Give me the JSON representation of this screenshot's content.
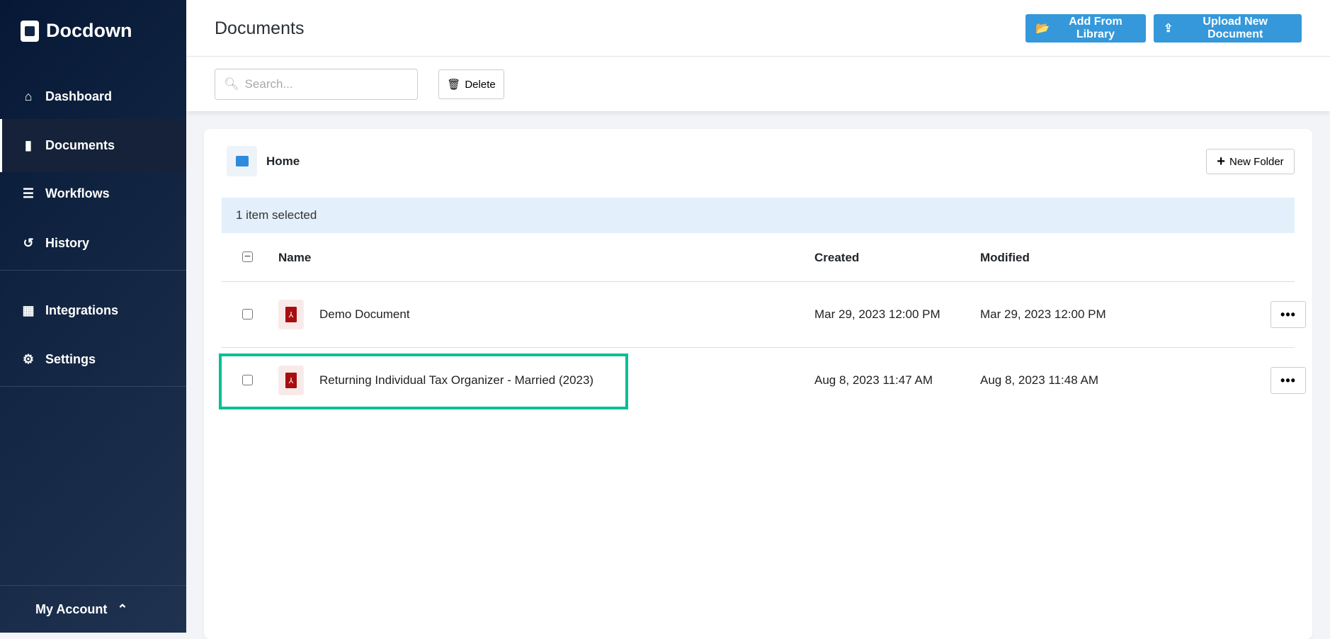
{
  "app": {
    "name": "Docdown"
  },
  "sidebar": {
    "items": [
      {
        "label": "Dashboard",
        "icon": "home-icon"
      },
      {
        "label": "Documents",
        "icon": "file-icon",
        "active": true
      },
      {
        "label": "Workflows",
        "icon": "list-icon"
      },
      {
        "label": "History",
        "icon": "history-icon"
      },
      {
        "label": "Integrations",
        "icon": "grid-icon"
      },
      {
        "label": "Settings",
        "icon": "gear-icon"
      }
    ],
    "account": "My Account"
  },
  "header": {
    "title": "Documents",
    "add_library": "Add From Library",
    "upload": "Upload New Document"
  },
  "toolbar": {
    "search_placeholder": "Search...",
    "delete": "Delete"
  },
  "folder": {
    "name": "Home",
    "new_folder": "New Folder",
    "selection": "1 item selected"
  },
  "table": {
    "columns": {
      "name": "Name",
      "created": "Created",
      "modified": "Modified"
    },
    "rows": [
      {
        "name": "Demo Document",
        "created": "Mar 29, 2023 12:00 PM",
        "modified": "Mar 29, 2023 12:00 PM",
        "more": "•••"
      },
      {
        "name": "Returning Individual Tax Organizer - Married (2023)",
        "created": "Aug 8, 2023 11:47 AM",
        "modified": "Aug 8, 2023 11:48 AM",
        "more": "•••"
      }
    ]
  },
  "colors": {
    "primary": "#3498db",
    "highlight": "#00bf96",
    "pdf": "#a80e10"
  }
}
